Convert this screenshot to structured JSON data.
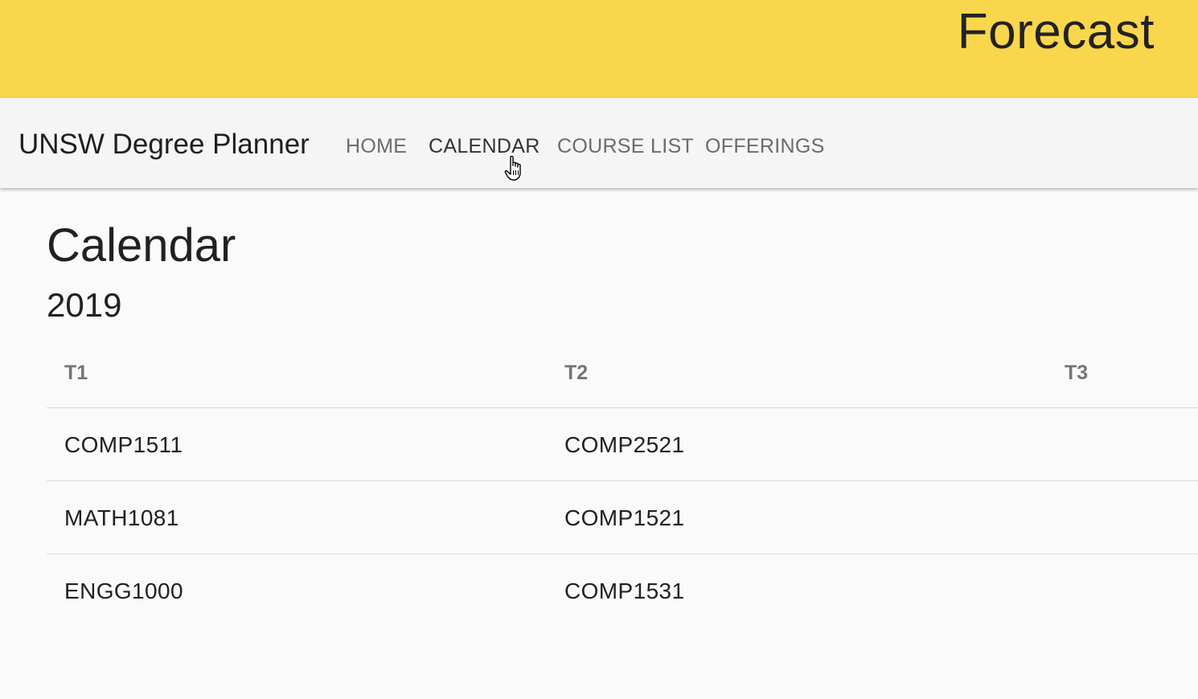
{
  "banner": {
    "title": "Forecast"
  },
  "nav": {
    "brand": "UNSW Degree Planner",
    "links": [
      "HOME",
      "CALENDAR",
      "COURSE LIST",
      "OFFERINGS"
    ],
    "active": "CALENDAR"
  },
  "page": {
    "title": "Calendar",
    "year": "2019"
  },
  "table": {
    "headers": [
      "T1",
      "T2",
      "T3"
    ],
    "rows": [
      [
        "COMP1511",
        "COMP2521",
        ""
      ],
      [
        "MATH1081",
        "COMP1521",
        ""
      ],
      [
        "ENGG1000",
        "COMP1531",
        ""
      ]
    ]
  },
  "colors": {
    "banner": "#f9d64c",
    "navbar": "#f5f5f5",
    "background": "#fafafa"
  }
}
